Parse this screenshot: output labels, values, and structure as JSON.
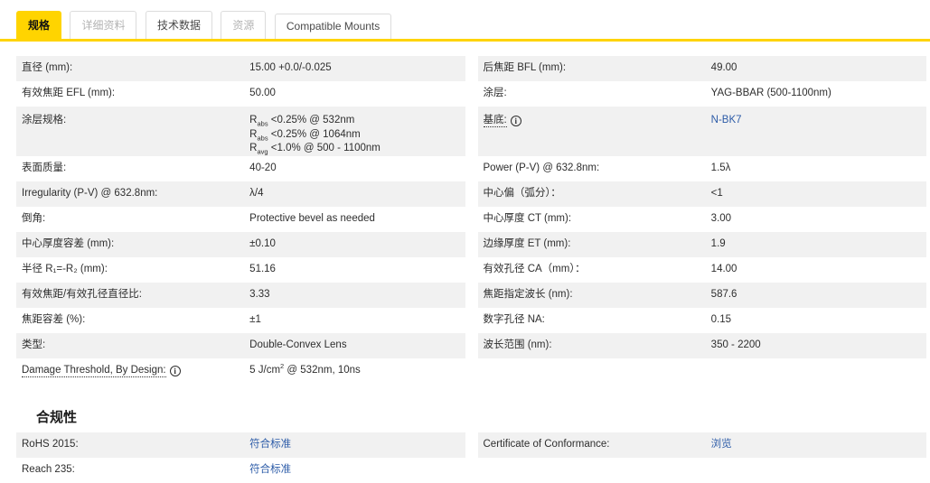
{
  "tabs": {
    "items": [
      {
        "label": "规格",
        "state": "active"
      },
      {
        "label": "详细资料",
        "state": "muted"
      },
      {
        "label": "技术数据",
        "state": "normal"
      },
      {
        "label": "资源",
        "state": "muted"
      },
      {
        "label": "Compatible Mounts",
        "state": "normal"
      }
    ]
  },
  "icons": {
    "info_glyph": "i"
  },
  "colors": {
    "accent_yellow": "#ffd400",
    "link_blue": "#2d5ca8",
    "row_stripe_gray": "#f1f1f1"
  },
  "specs": {
    "left": [
      {
        "label": "直径 (mm):",
        "value": "15.00 +0.0/-0.025"
      },
      {
        "label": "有效焦距 EFL (mm):",
        "value": "50.00"
      },
      {
        "label": "涂层规格:",
        "lines": [
          {
            "pre": "R",
            "sub": "abs",
            "post": " <0.25% @ 532nm"
          },
          {
            "pre": "R",
            "sub": "abs",
            "post": " <0.25% @ 1064nm"
          },
          {
            "pre": "R",
            "sub": "avg",
            "post": " <1.0% @ 500 - 1100nm"
          }
        ]
      },
      {
        "label": "表面质量:",
        "value": "40-20"
      },
      {
        "label": "Irregularity (P-V) @ 632.8nm:",
        "value": "λ/4"
      },
      {
        "label": "倒角:",
        "value": "Protective bevel as needed"
      },
      {
        "label": "中心厚度容差 (mm):",
        "value": "±0.10"
      },
      {
        "label": "半径 R₁=-R₂ (mm):",
        "value": "51.16"
      },
      {
        "label": "有效焦距/有效孔径直径比:",
        "value": "3.33"
      },
      {
        "label": "焦距容差 (%):",
        "value": "±1"
      },
      {
        "label": "类型:",
        "value": "Double-Convex Lens"
      },
      {
        "label": "Damage Threshold, By Design:",
        "value_pre": "5 J/cm",
        "value_sup": "2",
        "value_post": " @ 532nm, 10ns"
      }
    ],
    "right": [
      {
        "label": "后焦距 BFL (mm):",
        "value": "49.00"
      },
      {
        "label": "涂层:",
        "value": "YAG-BBAR (500-1100nm)"
      },
      {
        "label": "基底:",
        "value": "N-BK7"
      },
      {
        "label": "Power (P-V) @ 632.8nm:",
        "value": "1.5λ"
      },
      {
        "label": "中心偏（弧分）：",
        "value": "<1"
      },
      {
        "label": "中心厚度 CT (mm):",
        "value": "3.00"
      },
      {
        "label": "边缘厚度 ET (mm):",
        "value": "1.9"
      },
      {
        "label": "有效孔径 CA（mm）：",
        "value": "14.00"
      },
      {
        "label": "焦距指定波长 (nm):",
        "value": "587.6"
      },
      {
        "label": "数字孔径 NA:",
        "value": "0.15"
      },
      {
        "label": "波长范围 (nm):",
        "value": "350 - 2200"
      }
    ]
  },
  "compliance": {
    "heading": "合规性",
    "left": [
      {
        "label": "RoHS 2015:",
        "value": "符合标准"
      },
      {
        "label": "Reach 235:",
        "value": "符合标准"
      }
    ],
    "right": [
      {
        "label": "Certificate of Conformance:",
        "value": "浏览"
      }
    ]
  }
}
